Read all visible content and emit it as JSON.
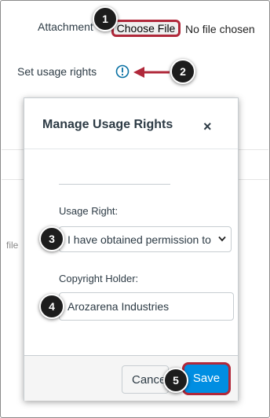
{
  "page": {
    "attachment_label": "Attachment",
    "choose_file_label": "Choose File",
    "no_file_text": "No file chosen",
    "usage_rights_label": "Set usage rights",
    "background_fragment": "file"
  },
  "callouts": [
    "1",
    "2",
    "3",
    "4",
    "5"
  ],
  "modal": {
    "title": "Manage Usage Rights",
    "close_symbol": "×",
    "usage_right_label": "Usage Right:",
    "usage_right_selected": "I have obtained permission to",
    "copyright_holder_label": "Copyright Holder:",
    "copyright_holder_value": "Arozarena Industries",
    "cancel_label": "Cancel",
    "save_label": "Save"
  },
  "colors": {
    "accent_red": "#b0283a",
    "primary_blue": "#008ee2",
    "text": "#2d3b45",
    "callout_bg": "#1d1d1d"
  },
  "icons": {
    "warning": "warning-circle-icon",
    "close": "close-icon",
    "select": "chevron-down-icon",
    "pointer": "arrow-left-icon"
  }
}
